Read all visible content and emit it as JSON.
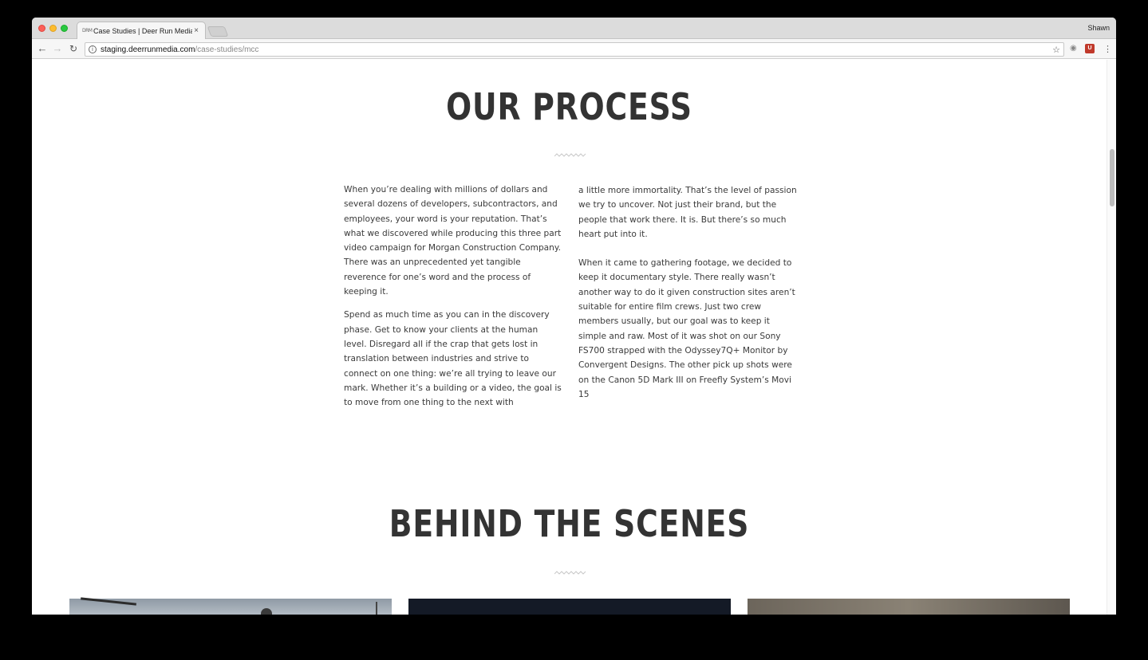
{
  "browser": {
    "tab_title": "Case Studies | Deer Run Media",
    "tab_favicon": "DRM",
    "tab_close": "×",
    "profile_name": "Shawn",
    "url_host": "staging.deerrunmedia.com",
    "url_path": "/case-studies/mcc",
    "icons": {
      "back": "back-arrow-icon",
      "forward": "forward-arrow-icon",
      "reload": "reload-icon",
      "info": "info-icon",
      "bookmark": "star-icon",
      "camera": "camera-icon",
      "extension": "shield-extension-icon",
      "menu": "kebab-menu-icon"
    }
  },
  "process": {
    "title": "OUR PROCESS",
    "left_paragraphs": [
      "When you’re dealing with millions of dollars and several dozens of developers, subcontractors, and employees, your word is your reputation. That’s what we discovered while producing this three part video campaign for Morgan Construction Company. There was an unprecedented yet tangible reverence for one’s word and the process of keeping it.",
      "Spend as much time as you can in the discovery phase. Get to know your clients at the human level. Disregard all if the crap that gets lost in translation between industries and strive to connect on one thing: we’re all trying to leave our mark. Whether it’s a building or a video, the goal is to move from one thing to the next with"
    ],
    "right_paragraphs": [
      "a little more immortality. That’s the level of passion we try to uncover. Not just their brand, but the people that work there. It is. But there’s so much heart put into it.",
      "When it came to gathering footage, we decided to keep it documentary style. There really wasn’t another way to do it given construction sites aren’t suitable for entire film crews. Just two crew members usually, but our goal was to keep it simple and raw. Most of it was shot on our Sony FS700 strapped with the Odyssey7Q+ Monitor by Convergent Designs. The other pick up shots were on the Canon 5D Mark III on Freefly System’s Movi 15"
    ]
  },
  "behind": {
    "title": "BEHIND THE SCENES"
  },
  "colors": {
    "heading": "#333333",
    "body_text": "#3a3a3a",
    "squiggle": "#c9c9c9"
  }
}
